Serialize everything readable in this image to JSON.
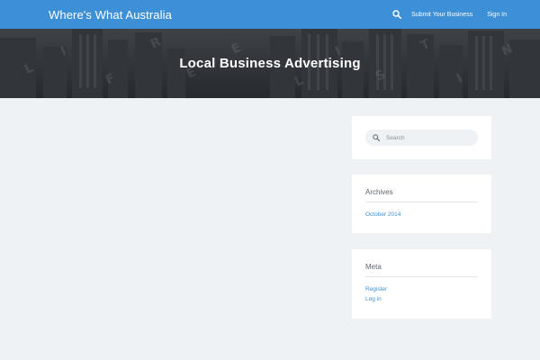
{
  "header": {
    "brand": "Where's What Australia",
    "nav": {
      "search_icon": "search-icon",
      "submit_label": "Submit Your Business",
      "signin_label": "Sign In"
    },
    "color": "#3d8fd6"
  },
  "hero": {
    "title": "Local Business Advertising",
    "watermark": "FREE LISTING"
  },
  "sidebar": {
    "search": {
      "placeholder": "Search",
      "icon": "search-icon"
    },
    "archives": {
      "title": "Archives",
      "items": [
        "October 2014"
      ]
    },
    "meta": {
      "title": "Meta",
      "items": [
        "Register",
        "Log in"
      ]
    }
  }
}
